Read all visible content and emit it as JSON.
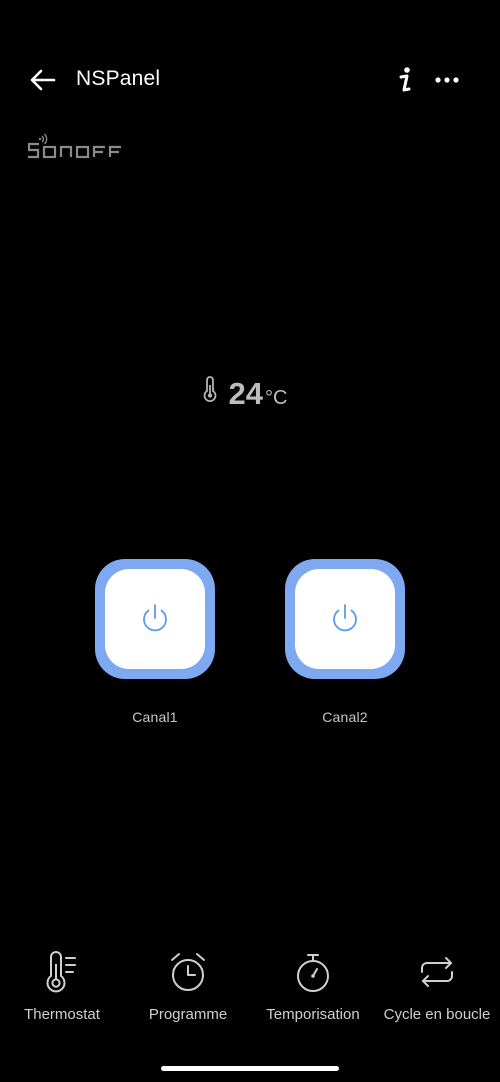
{
  "header": {
    "title": "NSPanel",
    "back_icon": "arrow-left-icon",
    "info_icon": "info-icon",
    "more_icon": "more-dots-icon"
  },
  "brand": {
    "logo_text": "SONOFF"
  },
  "temperature": {
    "icon": "thermometer-icon",
    "value": "24",
    "unit": "°C"
  },
  "channels": [
    {
      "label": "Canal1",
      "icon": "power-icon"
    },
    {
      "label": "Canal2",
      "icon": "power-icon"
    }
  ],
  "bottom_nav": [
    {
      "label": "Thermostat",
      "icon": "thermostat-icon"
    },
    {
      "label": "Programme",
      "icon": "alarm-clock-icon"
    },
    {
      "label": "Temporisation",
      "icon": "stopwatch-icon"
    },
    {
      "label": "Cycle en boucle",
      "icon": "loop-icon"
    }
  ],
  "colors": {
    "background": "#000000",
    "switch_accent": "#7ea8f0",
    "power_icon": "#5a9be8",
    "text_muted": "#c8c8c8"
  }
}
